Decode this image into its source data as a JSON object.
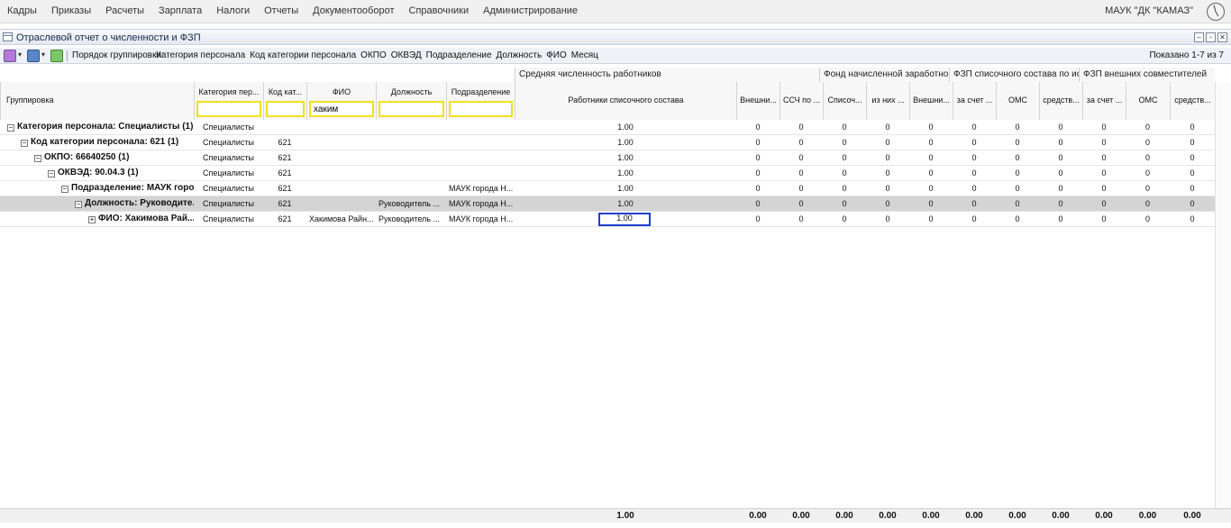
{
  "menu": [
    "Кадры",
    "Приказы",
    "Расчеты",
    "Зарплата",
    "Налоги",
    "Отчеты",
    "Документооборот",
    "Справочники",
    "Администрирование"
  ],
  "organization": "МАУК \"ДК \"КАМАЗ\"",
  "window": {
    "title": "Отраслевой отчет о численности и ФЗП"
  },
  "toolbar": {
    "group_label": "Порядок группировки:",
    "group_items": [
      "Категория персонала",
      "Код категории персонала",
      "ОКПО",
      "ОКВЭД",
      "Подразделение",
      "Должность",
      "ФИО",
      "Месяц"
    ],
    "shown": "Показано 1-7 из 7"
  },
  "bands": {
    "avg": "Средняя численность работников",
    "fond": "Фонд начисленной заработной...",
    "fzp_list": "ФЗП списочного состава по ист...",
    "fzp_ext": "ФЗП внешних совместителей"
  },
  "headers": {
    "grouping": "Группировка",
    "category": "Категория пер...",
    "code": "Код кат...",
    "fio": "ФИО",
    "position": "Должность",
    "division": "Подразделение",
    "list_staff": "Работники списочного состава",
    "c1": "Внешни...",
    "c2": "ССЧ по ...",
    "c3": "Списоч...",
    "c4": "из них ...",
    "c5": "Внешни...",
    "c6": "за счет ...",
    "c7": "ОМС",
    "c8": "средств...",
    "c9": "за счет ...",
    "c10": "ОМС",
    "c11": "средств..."
  },
  "filters": {
    "category": "",
    "code": "",
    "fio": "хаким",
    "position": "",
    "division": ""
  },
  "rows": [
    {
      "group": "Категория персонала: Специалисты (1)",
      "category": "Специалисты",
      "code": "",
      "fio": "",
      "position": "",
      "division": "",
      "list": "1.00",
      "nums": [
        "0",
        "0",
        "0",
        "0",
        "0",
        "0",
        "0",
        "0",
        "0",
        "0",
        "0"
      ]
    },
    {
      "group": "Код категории персонала: 621 (1)",
      "category": "Специалисты",
      "code": "621",
      "fio": "",
      "position": "",
      "division": "",
      "list": "1.00",
      "nums": [
        "0",
        "0",
        "0",
        "0",
        "0",
        "0",
        "0",
        "0",
        "0",
        "0",
        "0"
      ]
    },
    {
      "group": "ОКПО: 66640250 (1)",
      "category": "Специалисты",
      "code": "621",
      "fio": "",
      "position": "",
      "division": "",
      "list": "1.00",
      "nums": [
        "0",
        "0",
        "0",
        "0",
        "0",
        "0",
        "0",
        "0",
        "0",
        "0",
        "0"
      ]
    },
    {
      "group": "ОКВЭД: 90.04.3 (1)",
      "category": "Специалисты",
      "code": "621",
      "fio": "",
      "position": "",
      "division": "",
      "list": "1.00",
      "nums": [
        "0",
        "0",
        "0",
        "0",
        "0",
        "0",
        "0",
        "0",
        "0",
        "0",
        "0"
      ]
    },
    {
      "group": "Подразделение: МАУК горо...",
      "category": "Специалисты",
      "code": "621",
      "fio": "",
      "position": "",
      "division": "МАУК города Н...",
      "list": "1.00",
      "nums": [
        "0",
        "0",
        "0",
        "0",
        "0",
        "0",
        "0",
        "0",
        "0",
        "0",
        "0"
      ]
    },
    {
      "group": "Должность: Руководите...",
      "category": "Специалисты",
      "code": "621",
      "fio": "",
      "position": "Руководитель ...",
      "division": "МАУК города Н...",
      "list": "1.00",
      "nums": [
        "0",
        "0",
        "0",
        "0",
        "0",
        "0",
        "0",
        "0",
        "0",
        "0",
        "0"
      ]
    },
    {
      "group": "ФИО: Хакимова Рай...",
      "category": "Специалисты",
      "code": "621",
      "fio": "Хакимова Райн...",
      "position": "Руководитель ...",
      "division": "МАУК города Н...",
      "list": "1.00",
      "nums": [
        "0",
        "0",
        "0",
        "0",
        "0",
        "0",
        "0",
        "0",
        "0",
        "0",
        "0"
      ]
    }
  ],
  "totals": {
    "list": "1.00",
    "nums": [
      "0.00",
      "0.00",
      "0.00",
      "0.00",
      "0.00",
      "0.00",
      "0.00",
      "0.00",
      "0.00",
      "0.00",
      "0.00"
    ]
  }
}
